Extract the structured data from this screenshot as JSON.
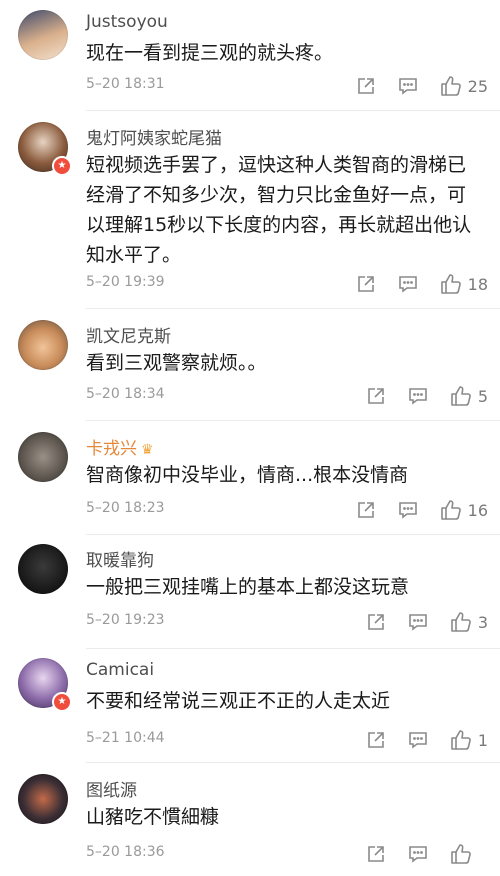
{
  "comments": [
    {
      "user": "Justsoyou",
      "text": "现在一看到提三观的就头疼。",
      "time": "5–20 18:31",
      "likes": "25"
    },
    {
      "user": "鬼灯阿姨家蛇尾猫",
      "text": "短视频选手罢了，逗快这种人类智商的滑梯已经滑了不知多少次，智力只比金鱼好一点，可以理解15秒以下长度的内容，再长就超出他认知水平了。",
      "time": "5–20 19:39",
      "likes": "18"
    },
    {
      "user": "凯文尼克斯",
      "text": "看到三观警察就烦。。",
      "time": "5–20 18:34",
      "likes": "5"
    },
    {
      "user": "卡戎兴",
      "text": "智商像初中没毕业，情商...根本没情商",
      "time": "5–20 18:23",
      "likes": "16"
    },
    {
      "user": "取暖靠狗",
      "text": "一般把三观挂嘴上的基本上都没这玩意",
      "time": "5–20 19:23",
      "likes": "3"
    },
    {
      "user": "Camicai",
      "text": "不要和经常说三观正不正的人走太近",
      "time": "5–21 10:44",
      "likes": "1"
    },
    {
      "user": "图纸源",
      "text": "山豬吃不慣細糠",
      "time": "5–20 18:36",
      "likes": ""
    }
  ],
  "icons": {
    "share": "share-icon",
    "reply": "reply-icon",
    "like": "thumbs-up-icon",
    "verified": "verified-badge-icon",
    "vip": "crown-icon"
  },
  "colors": {
    "username": "#4e4e4e",
    "vip_username": "#e5883a",
    "badge": "#f04d3c",
    "meta": "#9a9a9a"
  }
}
